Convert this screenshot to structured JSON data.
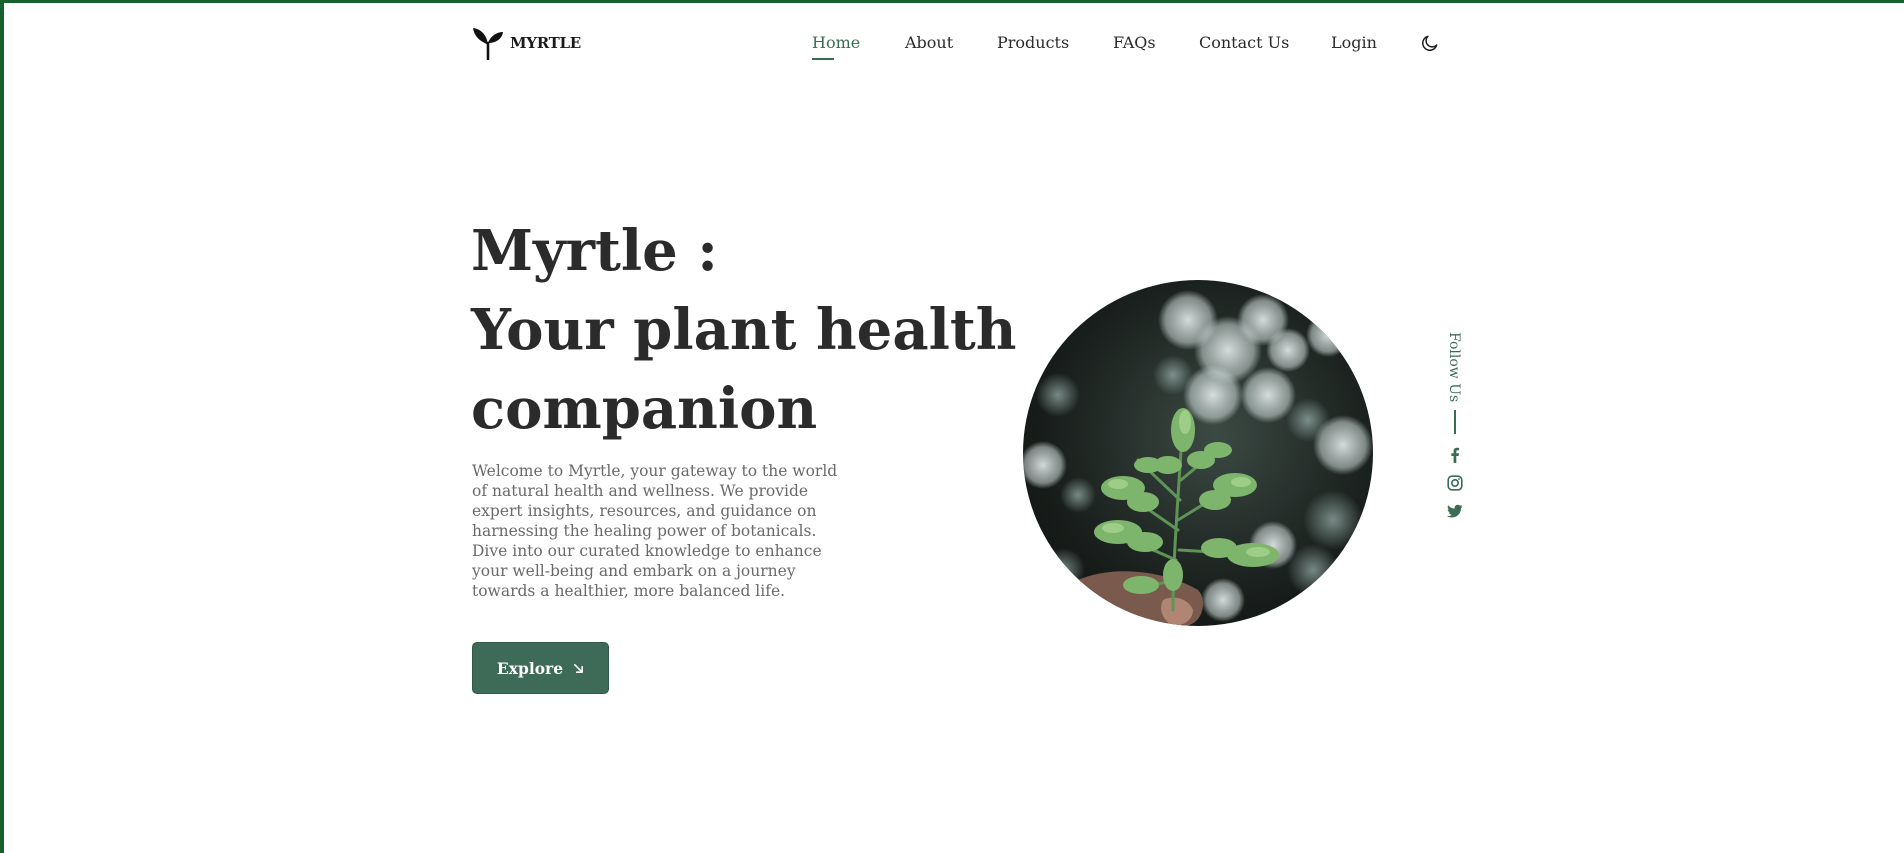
{
  "brand": {
    "name": "MYRTLE",
    "logo_icon": "sprout-icon"
  },
  "nav": {
    "items": [
      {
        "label": "Home",
        "active": true
      },
      {
        "label": "About"
      },
      {
        "label": "Products"
      },
      {
        "label": "FAQs"
      },
      {
        "label": "Contact Us"
      },
      {
        "label": "Login"
      }
    ],
    "theme_toggle_icon": "moon-icon"
  },
  "hero": {
    "title_lines": [
      "Myrtle :",
      "Your plant health",
      "companion"
    ],
    "description": "Welcome to Myrtle, your gateway to the world of natural health and wellness. We provide expert insights, resources, and guidance on harnessing the healing power of botanicals. Dive into our curated knowledge to enhance your well-being and embark on a journey towards a healthier, more balanced life.",
    "cta_label": "Explore",
    "cta_icon": "arrow-down-right-icon",
    "image_subject": "hand-holding-green-plant"
  },
  "social": {
    "follow_label": "Follow Us",
    "icons": [
      "facebook-icon",
      "instagram-icon",
      "twitter-icon"
    ]
  },
  "colors": {
    "accent": "#3a6b55",
    "button_bg": "#3d6b57",
    "frame": "#16622e",
    "text": "#2b2b2b",
    "muted_text": "#6a6a6a"
  }
}
